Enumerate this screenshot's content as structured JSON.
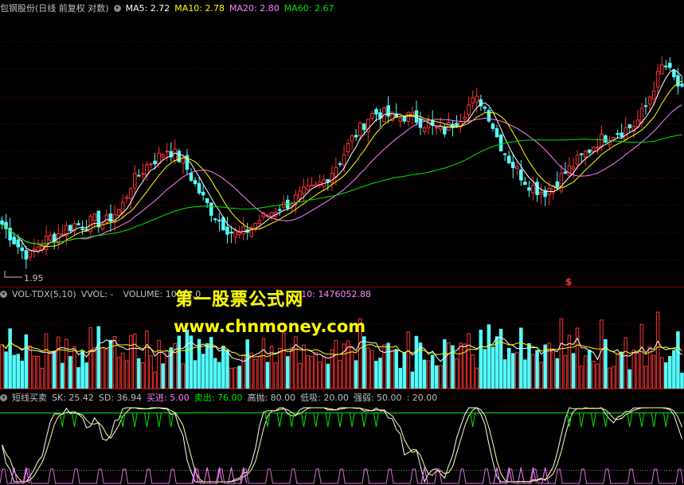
{
  "price_header": {
    "title": "包钢股份(日线 前复权 对数)",
    "ma5": "MA5: 2.72",
    "ma10": "MA10: 2.78",
    "ma20": "MA20: 2.80",
    "ma60": "MA60: 2.67",
    "low_label": "1.95",
    "marker": "$"
  },
  "volume_header": {
    "title": "VOL-TDX(5,10)",
    "vvol": "VVOL: -",
    "volume": "VOLUME: 10",
    "hidden": "84.0",
    "mavol": "10: 1476052.88"
  },
  "indicator_header": {
    "title": "短线买卖",
    "sk": "SK: 25.42",
    "sd": "SD: 36.94",
    "buy": "买进: 5.00",
    "sell": "卖出: 76.00",
    "high": "高抛: 80.00",
    "low": "低吸: 20.00",
    "strength": "强弱: 50.00",
    "extra": ": 20.00"
  },
  "watermark": {
    "line1": "第一股票公式网",
    "line2": "www.chnmoney.com"
  },
  "colors": {
    "up": "#ff3232",
    "down": "#54fcfc",
    "ma5": "#ffffff",
    "ma10": "#ffff00",
    "ma20": "#ff80ff",
    "ma60": "#00e600",
    "grid": "#800000",
    "label": "#c0c0c0",
    "buy": "#ff80ff",
    "sell": "#00e600"
  },
  "chart_data": {
    "type": "candlestick",
    "series_names": [
      "MA5",
      "MA10",
      "MA20",
      "MA60"
    ],
    "min_price": 1.95,
    "last_values": {
      "MA5": 2.72,
      "MA10": 2.78,
      "MA20": 2.8,
      "MA60": 2.67
    },
    "closes": [
      2.1,
      2.04,
      1.98,
      1.95,
      2.0,
      2.03,
      2.05,
      2.08,
      2.1,
      2.09,
      2.12,
      2.1,
      2.14,
      2.18,
      2.3,
      2.36,
      2.42,
      2.45,
      2.5,
      2.46,
      2.4,
      2.3,
      2.22,
      2.15,
      2.1,
      2.06,
      2.05,
      2.08,
      2.12,
      2.15,
      2.18,
      2.2,
      2.23,
      2.26,
      2.28,
      2.32,
      2.38,
      2.45,
      2.55,
      2.62,
      2.7,
      2.72,
      2.7,
      2.68,
      2.7,
      2.68,
      2.65,
      2.62,
      2.6,
      2.65,
      2.7,
      2.78,
      2.8,
      2.7,
      2.55,
      2.45,
      2.38,
      2.32,
      2.28,
      2.26,
      2.3,
      2.35,
      2.4,
      2.45,
      2.5,
      2.55,
      2.58,
      2.6,
      2.62,
      2.65,
      2.75,
      2.9,
      3.05,
      2.95,
      2.85
    ]
  }
}
